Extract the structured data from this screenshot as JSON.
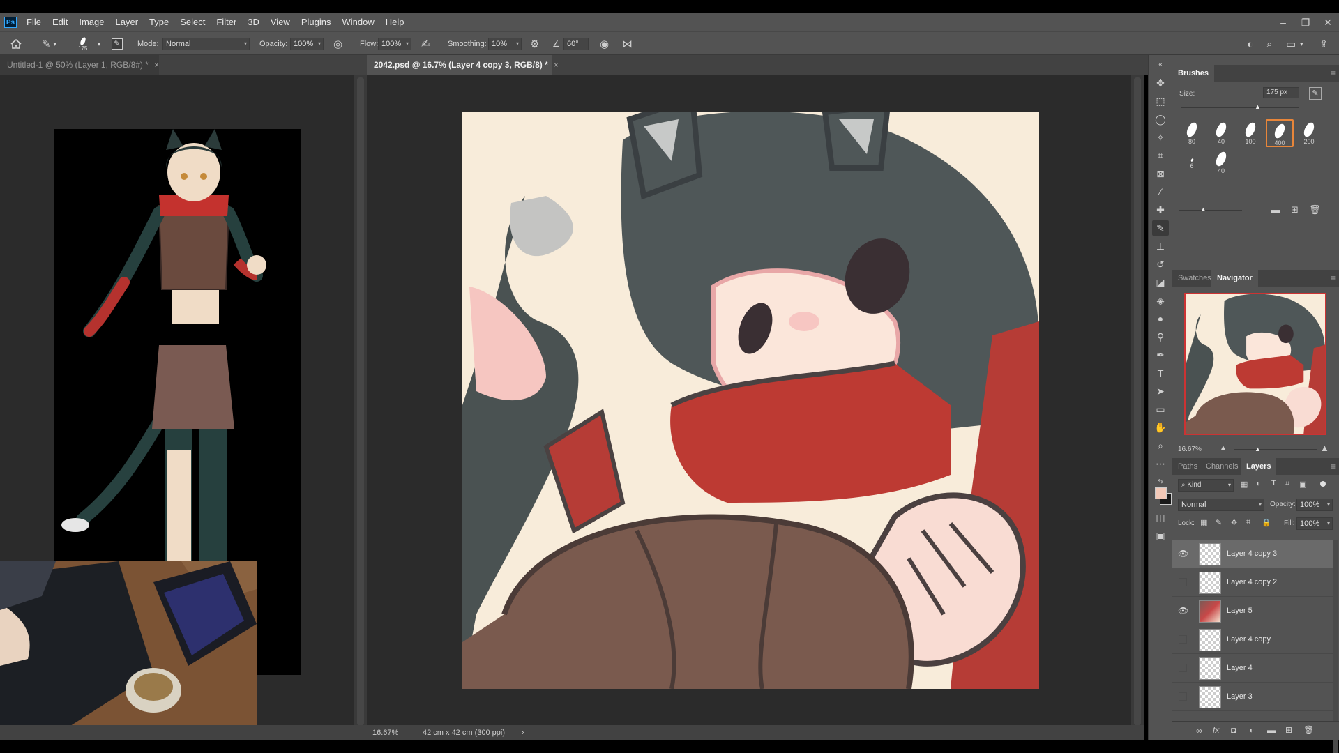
{
  "menubar": {
    "logo": "Ps",
    "items": [
      "File",
      "Edit",
      "Image",
      "Layer",
      "Type",
      "Select",
      "Filter",
      "3D",
      "View",
      "Plugins",
      "Window",
      "Help"
    ]
  },
  "options": {
    "brush_size": "175",
    "mode_label": "Mode:",
    "mode_value": "Normal",
    "opacity_label": "Opacity:",
    "opacity_value": "100%",
    "flow_label": "Flow:",
    "flow_value": "100%",
    "smoothing_label": "Smoothing:",
    "smoothing_value": "10%",
    "angle_value": "60°"
  },
  "tabs": [
    {
      "label": "Untitled-1 @ 50% (Layer 1, RGB/8#) *",
      "close": "×"
    },
    {
      "label": "2042.psd @ 16.7% (Layer 4 copy 3, RGB/8) *",
      "close": "×"
    }
  ],
  "status": {
    "zoom": "16.67%",
    "doc_size": "42 cm x 42 cm (300 ppi)",
    "arrow": "›"
  },
  "brushes": {
    "title": "Brushes",
    "size_label": "Size:",
    "size_value": "175 px",
    "tips": [
      "80",
      "40",
      "100",
      "400",
      "200",
      "6",
      "40"
    ],
    "selected_index": 3
  },
  "navigator": {
    "tabs": [
      "Swatches",
      "Navigator"
    ],
    "zoom": "16.67%"
  },
  "layers_panel": {
    "tabs": [
      "Paths",
      "Channels",
      "Layers"
    ],
    "kind_label": "Kind",
    "blend_mode": "Normal",
    "opacity_label": "Opacity:",
    "opacity_value": "100%",
    "lock_label": "Lock:",
    "fill_label": "Fill:",
    "fill_value": "100%",
    "layers": [
      {
        "name": "Layer 4 copy 3",
        "visible": true,
        "selected": true
      },
      {
        "name": "Layer 4 copy 2",
        "visible": false,
        "selected": false
      },
      {
        "name": "Layer 5",
        "visible": true,
        "selected": false
      },
      {
        "name": "Layer 4 copy",
        "visible": false,
        "selected": false
      },
      {
        "name": "Layer 4",
        "visible": false,
        "selected": false
      },
      {
        "name": "Layer 3",
        "visible": false,
        "selected": false
      }
    ]
  },
  "colors": {
    "foreground": "#f3c9b8",
    "background": "#1a1a1a",
    "accent": "#e8863a"
  }
}
